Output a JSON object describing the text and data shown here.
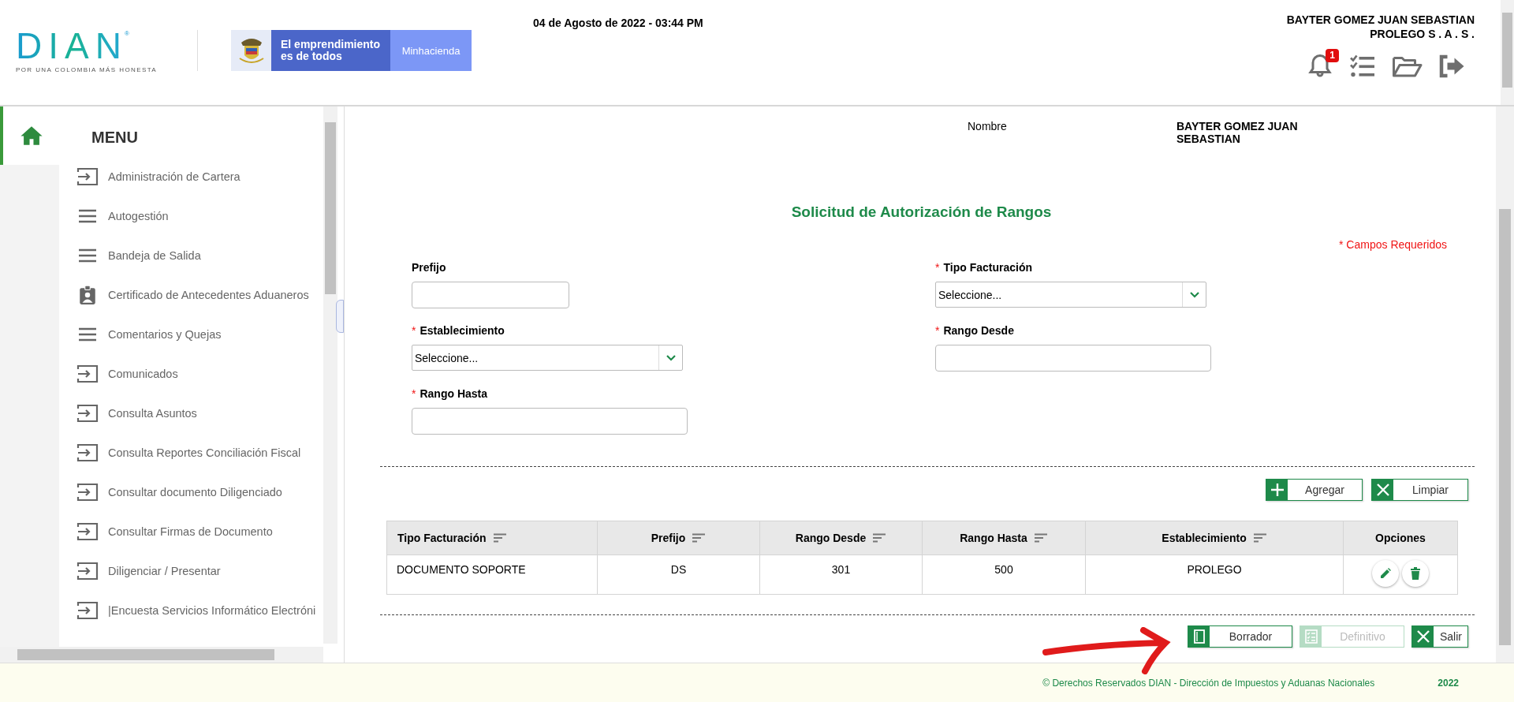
{
  "header": {
    "logo": {
      "name": "DIAN",
      "registered": "®",
      "slogan": "POR UNA COLOMBIA MÁS HONESTA"
    },
    "gov_banner": {
      "tagline": "El emprendimiento es de todos",
      "ministry": "Minhacienda"
    },
    "datetime": "04 de Agosto de 2022 - 03:44 PM",
    "user": "BAYTER GOMEZ JUAN SEBASTIAN",
    "company": "PROLEGO S . A . S .",
    "notifications_badge": "1"
  },
  "sidebar": {
    "title": "MENU",
    "items": [
      {
        "label": "Administración de Cartera",
        "kind": "arrow"
      },
      {
        "label": "Autogestión",
        "kind": "list"
      },
      {
        "label": "Bandeja de Salida",
        "kind": "list"
      },
      {
        "label": "Certificado de Antecedentes Aduaneros",
        "kind": "badge"
      },
      {
        "label": "Comentarios y Quejas",
        "kind": "list"
      },
      {
        "label": "Comunicados",
        "kind": "arrow"
      },
      {
        "label": "Consulta Asuntos",
        "kind": "arrow"
      },
      {
        "label": "Consulta Reportes Conciliación Fiscal",
        "kind": "arrow"
      },
      {
        "label": "Consultar documento Diligenciado",
        "kind": "arrow"
      },
      {
        "label": "Consultar Firmas de Documento",
        "kind": "arrow"
      },
      {
        "label": "Diligenciar / Presentar",
        "kind": "arrow"
      },
      {
        "label": "|Encuesta Servicios Informático Electróni",
        "kind": "arrow"
      }
    ]
  },
  "form": {
    "name_label": "Nombre",
    "name_value": "BAYTER GOMEZ JUAN SEBASTIAN",
    "title": "Solicitud de Autorización de Rangos",
    "required_note": "* Campos Requeridos",
    "fields": [
      {
        "label": "Prefijo",
        "kind": "text"
      },
      {
        "label": "Tipo Facturación",
        "required_mark": "*",
        "kind": "select",
        "value": "Seleccione..."
      },
      {
        "label": "Establecimiento",
        "required_mark": "*",
        "kind": "select",
        "value": "Seleccione..."
      },
      {
        "label": "Rango Desde",
        "required_mark": "*",
        "kind": "text"
      },
      {
        "label": "Rango Hasta",
        "required_mark": "*",
        "kind": "text"
      }
    ],
    "actions": [
      {
        "label": "Agregar",
        "kind": "add"
      },
      {
        "label": "Limpiar",
        "kind": "clear"
      }
    ]
  },
  "table": {
    "columns": [
      "Tipo Facturación",
      "Prefijo",
      "Rango Desde",
      "Rango Hasta",
      "Establecimiento",
      "Opciones"
    ],
    "rows": [
      {
        "cells": [
          "DOCUMENTO SOPORTE",
          "DS",
          "301",
          "500",
          "PROLEGO"
        ]
      }
    ]
  },
  "bottom_buttons": [
    {
      "label": "Borrador",
      "kind": "draft",
      "disabled": false
    },
    {
      "label": "Definitivo",
      "kind": "final",
      "disabled": true
    },
    {
      "label": "Salir",
      "kind": "exit",
      "disabled": false
    }
  ],
  "footer": {
    "copyright": "© Derechos Reservados DIAN - Dirección de Impuestos y Aduanas Nacionales",
    "year": "2022"
  }
}
